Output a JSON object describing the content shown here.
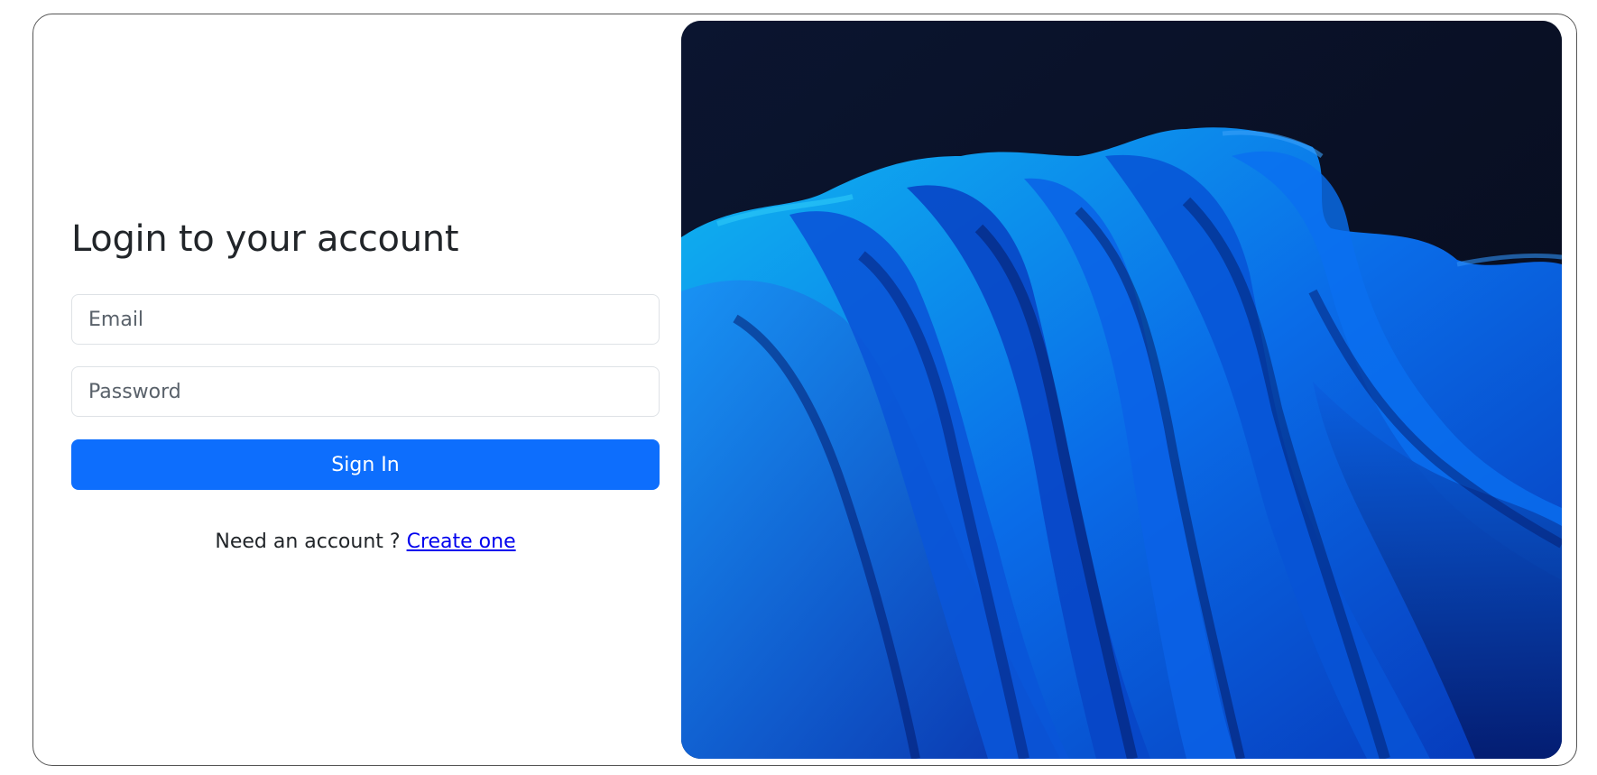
{
  "login": {
    "title": "Login to your account",
    "email_placeholder": "Email",
    "password_placeholder": "Password",
    "signin_label": "Sign In",
    "signup_prompt": "Need an account ?",
    "signup_link": "Create one"
  },
  "colors": {
    "primary": "#0d6efd",
    "link": "#0000ee",
    "hero_background": "#0a1228",
    "hero_accent": "#0a6cf0"
  },
  "hero": {
    "icon": "abstract-blue-waves-image"
  }
}
